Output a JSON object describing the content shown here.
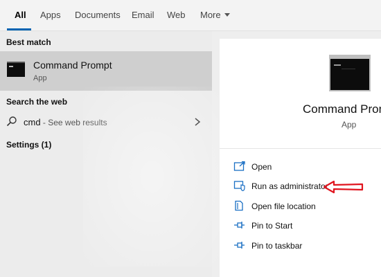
{
  "tabs": [
    {
      "label": "All",
      "active": true
    },
    {
      "label": "Apps",
      "active": false
    },
    {
      "label": "Documents",
      "active": false
    },
    {
      "label": "Email",
      "active": false
    },
    {
      "label": "Web",
      "active": false
    },
    {
      "label": "More",
      "active": false
    }
  ],
  "left": {
    "best_match_title": "Best match",
    "best_item": {
      "title": "Command Prompt",
      "subtitle": "App",
      "icon": "command-prompt-icon"
    },
    "search_web_title": "Search the web",
    "web_item": {
      "term": "cmd",
      "suffix": " - See web results",
      "icon": "search-icon"
    },
    "settings_title": "Settings (1)"
  },
  "right": {
    "title": "Command Prompt",
    "subtitle": "App",
    "icon": "command-prompt-icon",
    "actions": [
      {
        "label": "Open",
        "icon": "open-icon"
      },
      {
        "label": "Run as administrator",
        "icon": "shield-icon"
      },
      {
        "label": "Open file location",
        "icon": "file-location-icon"
      },
      {
        "label": "Pin to Start",
        "icon": "pin-icon"
      },
      {
        "label": "Pin to taskbar",
        "icon": "pin-icon"
      }
    ]
  },
  "annotation": {
    "icon": "red-arrow-icon",
    "color": "#e0141e"
  },
  "colors": {
    "accent": "#0063b1",
    "selected_bg": "#cfcfcf"
  }
}
